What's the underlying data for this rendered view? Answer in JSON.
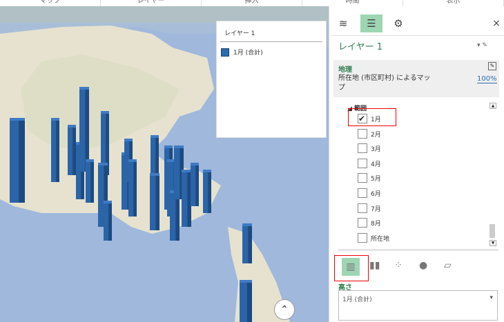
{
  "ribbon": {
    "tabs": [
      "マップ",
      "レイヤー",
      "挿入",
      "時間",
      "表示"
    ]
  },
  "legend": {
    "title": "レイヤー 1",
    "item": "1月 (合計)",
    "color": "#2b6cb0"
  },
  "panel": {
    "tab_icons": [
      "layers-icon",
      "field-list-icon",
      "settings-icon"
    ],
    "close": "×",
    "layer_name": "レイヤー 1",
    "geo_heading": "地理",
    "geo_desc": "所在地 (市区町村) によるマップ",
    "geo_pct": "100%",
    "range_heading": "範囲",
    "fields": [
      {
        "label": "1月",
        "checked": true
      },
      {
        "label": "2月",
        "checked": false
      },
      {
        "label": "3月",
        "checked": false
      },
      {
        "label": "4月",
        "checked": false
      },
      {
        "label": "5月",
        "checked": false
      },
      {
        "label": "6月",
        "checked": false
      },
      {
        "label": "7月",
        "checked": false
      },
      {
        "label": "8月",
        "checked": false
      },
      {
        "label": "所在地",
        "checked": false
      }
    ],
    "viz_types": [
      "stacked-column",
      "clustered-column",
      "bubble",
      "heat-map",
      "region"
    ],
    "height_label": "高さ",
    "height_value": "1月 (合計)"
  }
}
